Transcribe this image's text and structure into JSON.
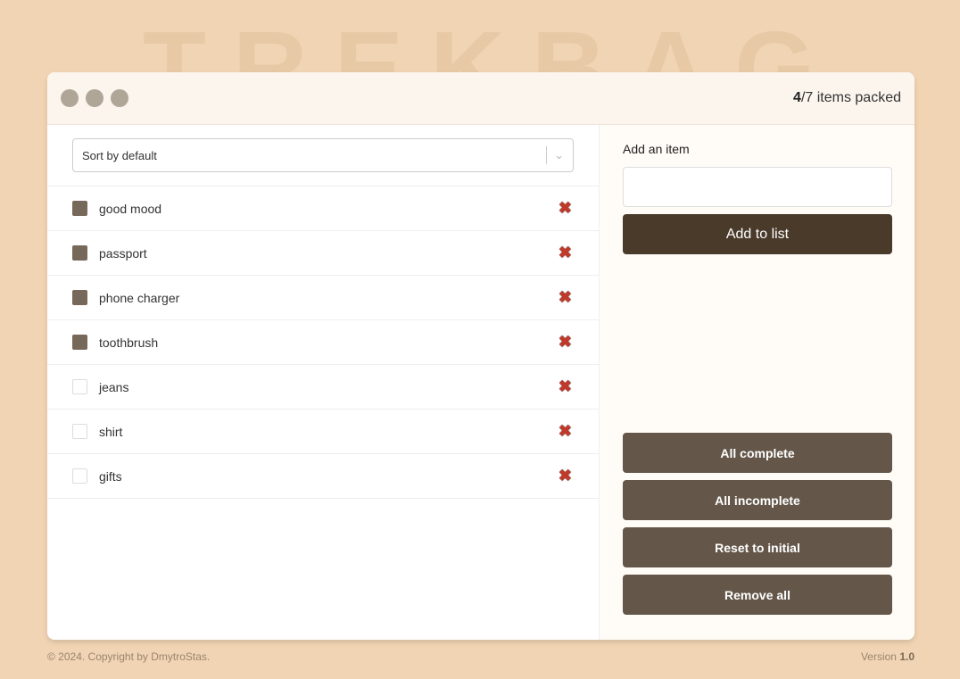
{
  "background_title": "TREKBAG",
  "header": {
    "packed": "4",
    "total_text": "/7 items packed"
  },
  "sort": {
    "selected": "Sort by default"
  },
  "items": [
    {
      "name": "good mood",
      "packed": true
    },
    {
      "name": "passport",
      "packed": true
    },
    {
      "name": "phone charger",
      "packed": true
    },
    {
      "name": "toothbrush",
      "packed": true
    },
    {
      "name": "jeans",
      "packed": false
    },
    {
      "name": "shirt",
      "packed": false
    },
    {
      "name": "gifts",
      "packed": false
    }
  ],
  "add_form": {
    "label": "Add an item",
    "value": "",
    "button": "Add to list"
  },
  "actions": [
    "All complete",
    "All incomplete",
    "Reset to initial",
    "Remove all"
  ],
  "footer": {
    "copyright": "© 2024. Copyright by DmytroStas.",
    "version_label": "Version ",
    "version": "1.0"
  },
  "colors": {
    "background": "#f1d4b3",
    "accent": "#4a3a2a",
    "button": "#64574a",
    "delete": "#c0392b"
  }
}
